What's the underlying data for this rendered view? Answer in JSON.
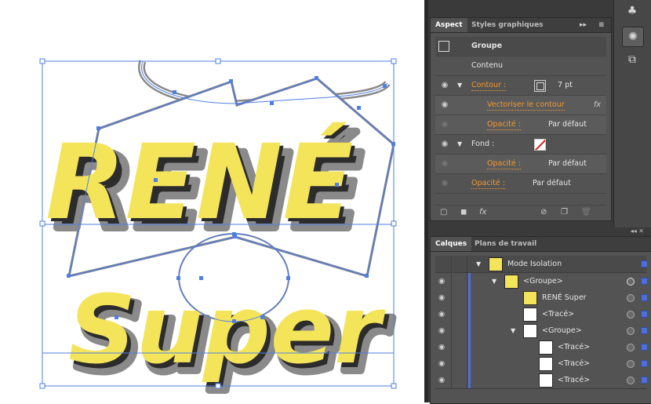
{
  "canvas": {
    "art_line1": "RENÉ",
    "art_line2": "Super",
    "colors": {
      "fill": "#f4e45a",
      "shadow": "#2c2c2c",
      "outline": "#8a8a8a",
      "selection": "#4f7fe0"
    }
  },
  "appearance_panel": {
    "tabs": [
      "Aspect",
      "Styles graphiques"
    ],
    "header_title": "Groupe",
    "content_label": "Contenu",
    "rows": {
      "stroke_label": "Contour :",
      "stroke_value": "7 pt",
      "vectorize_label": "Vectoriser le contour",
      "fx_label": "fx",
      "stroke_opacity_label": "Opacité :",
      "stroke_opacity_value": "Par défaut",
      "fill_label": "Fond :",
      "fill_opacity_label": "Opacité :",
      "fill_opacity_value": "Par défaut",
      "opacity_label": "Opacité :",
      "opacity_value": "Par défaut"
    },
    "menu_glyph": "▸▸",
    "footer_fx": "fx"
  },
  "layers_panel": {
    "tabs": [
      "Calques",
      "Plans de travail"
    ],
    "rows": [
      {
        "name": "Mode Isolation"
      },
      {
        "name": "<Groupe>"
      },
      {
        "name": "RENÉ Super"
      },
      {
        "name": "<Tracé>"
      },
      {
        "name": "<Groupe>"
      },
      {
        "name": "<Tracé>"
      },
      {
        "name": "<Tracé>"
      },
      {
        "name": "<Tracé>"
      }
    ]
  },
  "toolstrip": {
    "icons": [
      "club-icon",
      "appearance-icon",
      "transform-icon"
    ]
  }
}
